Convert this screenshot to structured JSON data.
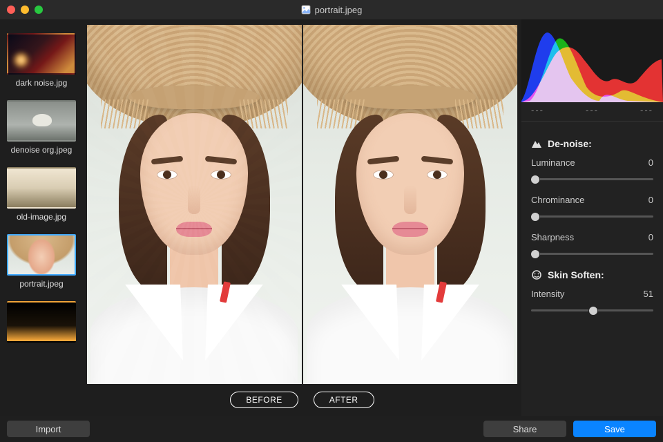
{
  "title": "portrait.jpeg",
  "sidebar": {
    "thumbs": [
      {
        "file": "dark noise.jpg",
        "kind": "dark"
      },
      {
        "file": "denoise org.jpeg",
        "kind": "denoise"
      },
      {
        "file": "old-image.jpg",
        "kind": "old"
      },
      {
        "file": "portrait.jpeg",
        "kind": "portrait",
        "selected": true
      },
      {
        "file": "",
        "kind": "night"
      }
    ]
  },
  "preview": {
    "before_label": "BEFORE",
    "after_label": "AFTER"
  },
  "histogram_readouts": [
    "---",
    "---",
    "---"
  ],
  "panels": {
    "denoise": {
      "title": "De-noise:",
      "sliders": [
        {
          "label": "Luminance",
          "value": 0,
          "min": 0,
          "max": 100
        },
        {
          "label": "Chrominance",
          "value": 0,
          "min": 0,
          "max": 100
        },
        {
          "label": "Sharpness",
          "value": 0,
          "min": 0,
          "max": 100
        }
      ]
    },
    "skin": {
      "title": "Skin Soften:",
      "sliders": [
        {
          "label": "Intensity",
          "value": 51,
          "min": 0,
          "max": 100
        }
      ]
    }
  },
  "footer": {
    "import": "Import",
    "share": "Share",
    "save": "Save"
  }
}
